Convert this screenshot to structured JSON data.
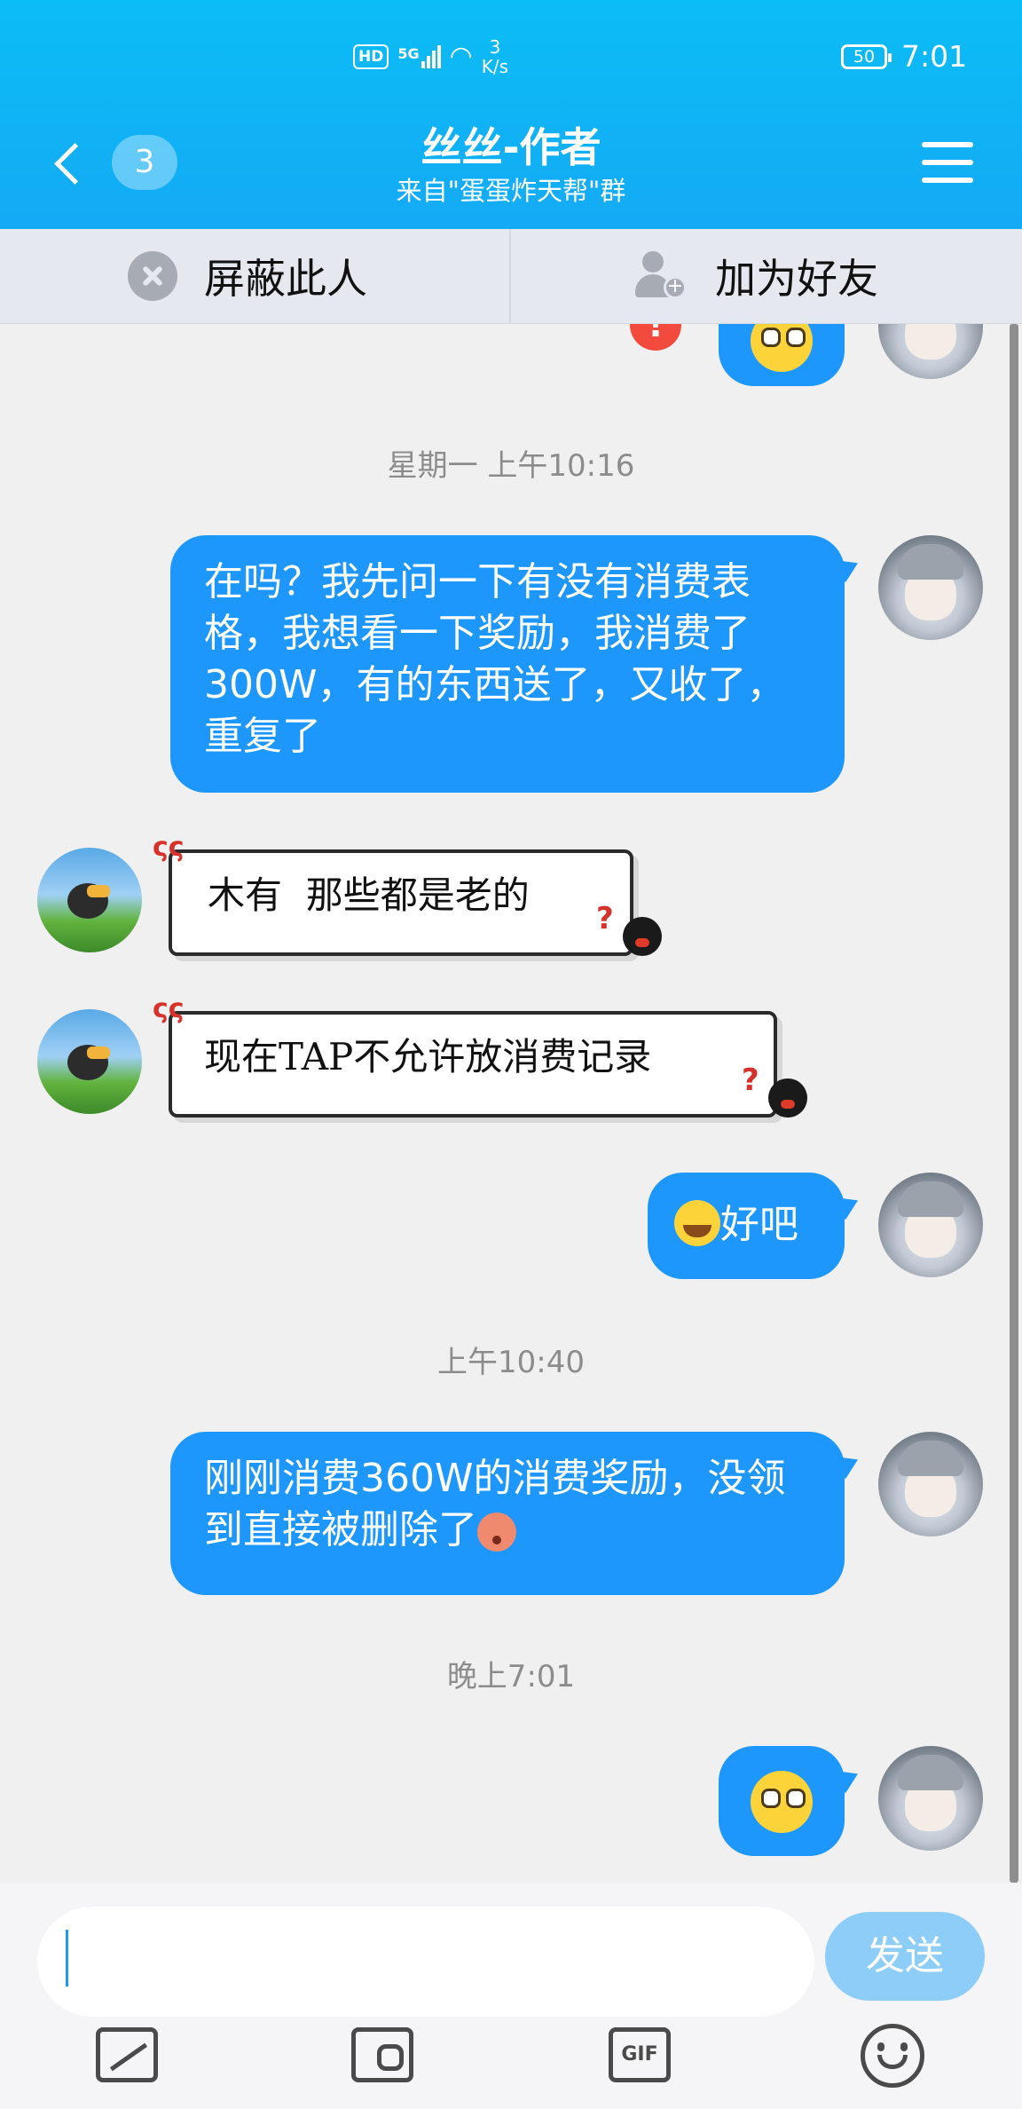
{
  "status_bar": {
    "hd": "HD",
    "signal": "5G",
    "net_speed_value": "3",
    "net_speed_unit": "K/s",
    "battery": "50",
    "time": "7:01"
  },
  "header": {
    "unread_count": "3",
    "title": "丝丝-作者",
    "subtitle": "来自\"蛋蛋炸天帮\"群"
  },
  "actions": {
    "block_label": "屏蔽此人",
    "add_friend_label": "加为好友"
  },
  "messages": {
    "stamp_1": "星期一 上午10:16",
    "msg_1": "在吗？我先问一下有没有消费表格，我想看一下奖励，我消费了300W，有的东西送了，又收了，重复了",
    "reply_1": "木有  那些都是老的",
    "reply_2": "现在TAP不允许放消费记录",
    "msg_2": "好吧",
    "stamp_2": "上午10:40",
    "msg_3": "刚刚消费360W的消费奖励，没领到直接被删除了",
    "stamp_3": "晚上7:01",
    "fail_mark": "!"
  },
  "input": {
    "placeholder": "",
    "send_label": "发送",
    "gif_label": "GIF"
  },
  "colors": {
    "header_blue": "#14aaf5",
    "bubble_blue": "#1d97fc",
    "send_disabled": "#8ecdf7"
  }
}
